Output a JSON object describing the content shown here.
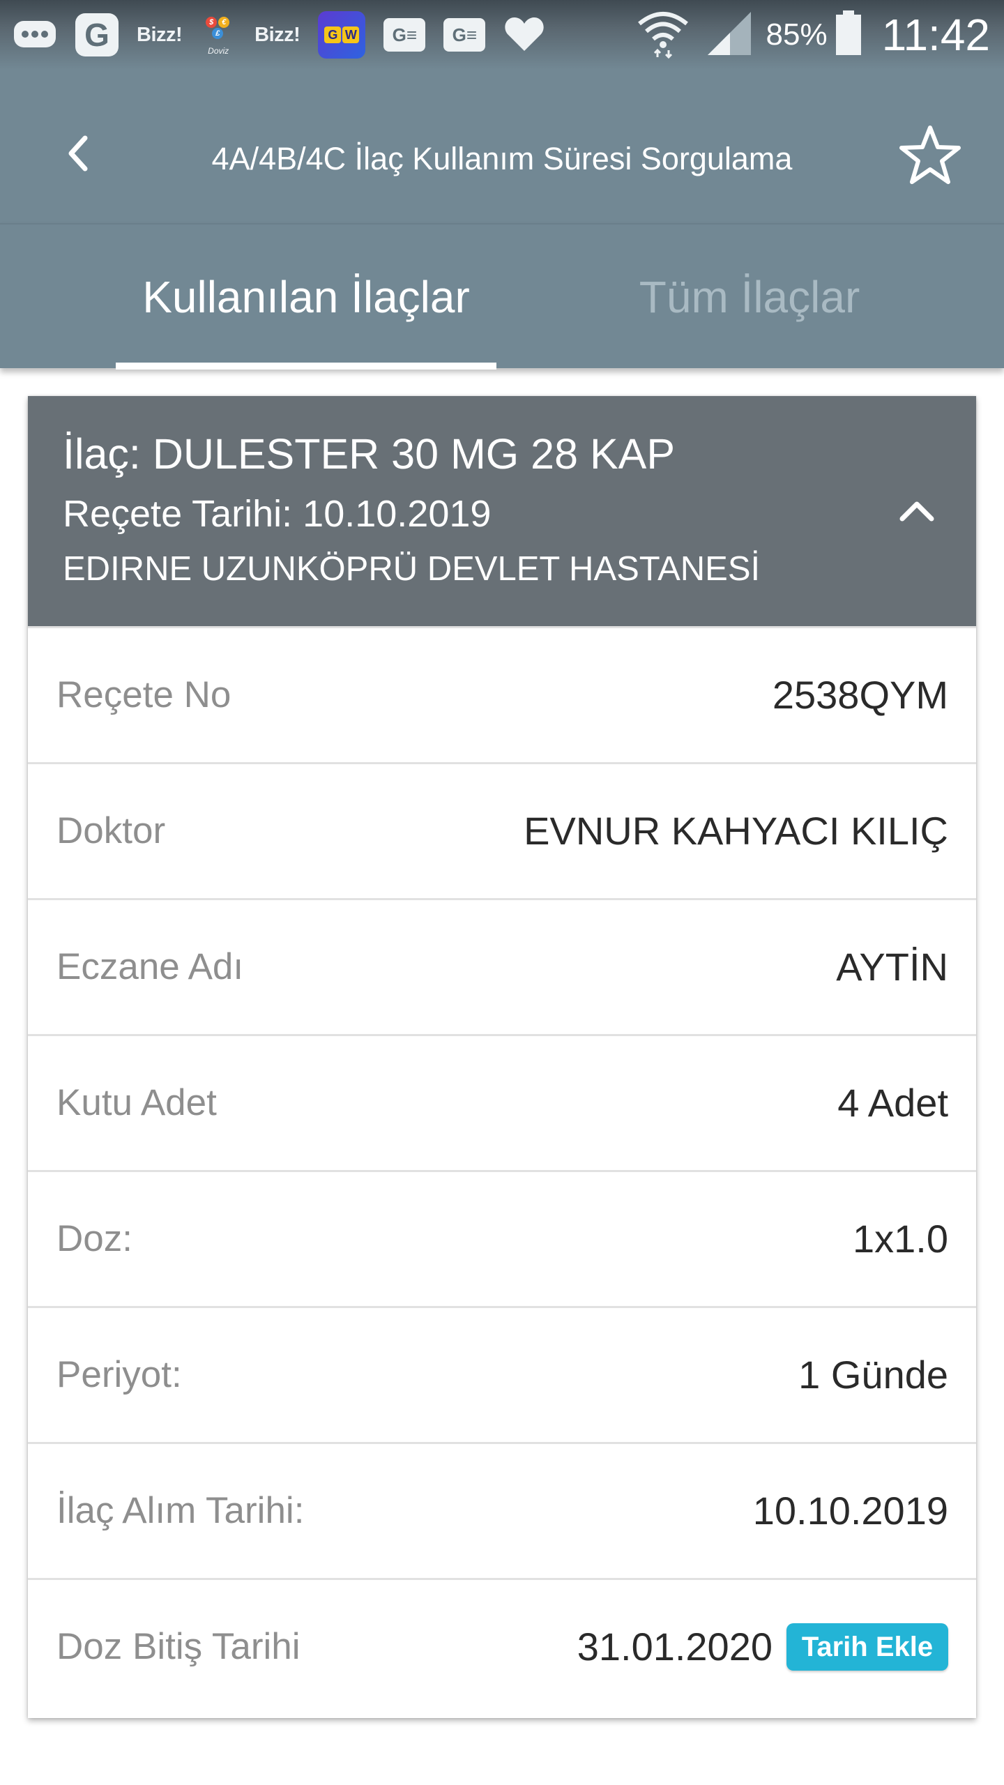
{
  "status_bar": {
    "icons": [
      "message-icon",
      "google-icon",
      "bizz-app-icon",
      "doviz-app-icon",
      "bizz-app-icon",
      "game-app-icon",
      "ge-app-icon",
      "ge-app-icon",
      "heart-icon"
    ],
    "bizz_1": "Bizz!",
    "bizz_2": "Bizz!",
    "doviz_label": "Doviz",
    "google_letter": "G",
    "gw_letters": [
      "G",
      "W"
    ],
    "ge_1": "G≡",
    "ge_2": "G≡",
    "battery_text": "85%",
    "time": "11:42"
  },
  "toolbar": {
    "title": "4A/4B/4C İlaç Kullanım Süresi Sorgulama"
  },
  "tabs": [
    {
      "label": "Kullanılan İlaçlar",
      "selected": true
    },
    {
      "label": "Tüm İlaçlar",
      "selected": false
    }
  ],
  "card": {
    "drug": "İlaç: DULESTER 30 MG 28 KAP",
    "prescription_date": "Reçete Tarihi: 10.10.2019",
    "hospital": "EDIRNE UZUNKÖPRÜ DEVLET HASTANESİ",
    "rows": [
      {
        "label": "Reçete No",
        "value": "2538QYM"
      },
      {
        "label": "Doktor",
        "value": "EVNUR KAHYACI KILIÇ"
      },
      {
        "label": "Eczane Adı",
        "value": "AYTİN"
      },
      {
        "label": "Kutu Adet",
        "value": "4 Adet"
      },
      {
        "label": "Doz:",
        "value": "1x1.0"
      },
      {
        "label": "Periyot:",
        "value": "1 Günde"
      },
      {
        "label": "İlaç Alım Tarihi:",
        "value": "10.10.2019"
      },
      {
        "label": "Doz Bitiş Tarihi",
        "value": "31.01.2020"
      }
    ],
    "add_date_button": "Tarih Ekle"
  },
  "colors": {
    "toolbar": "#728894",
    "card_header": "#687076",
    "accent_button": "#23b4d6"
  }
}
